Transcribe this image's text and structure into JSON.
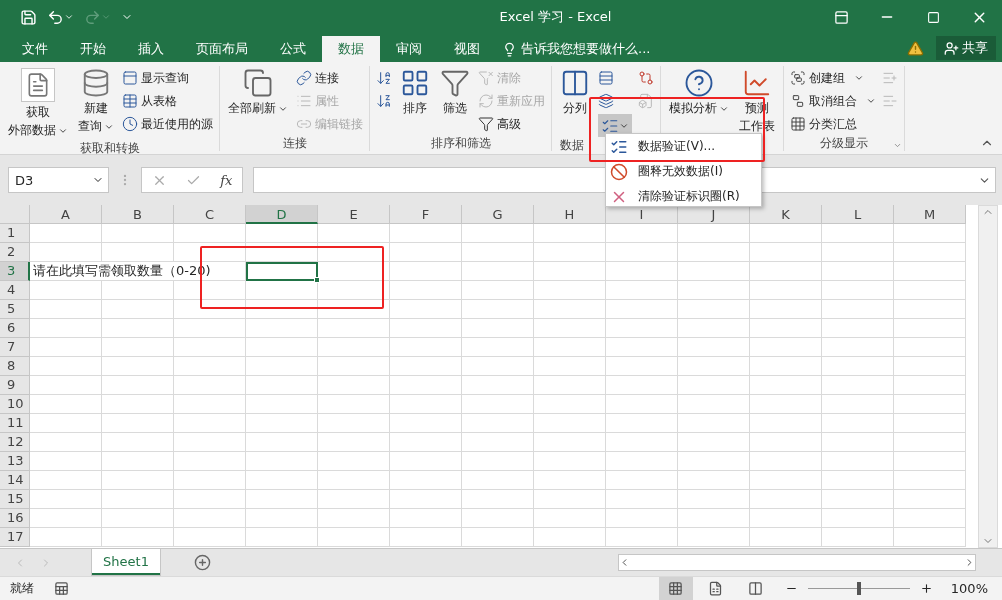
{
  "title_bar": {
    "title": "Excel 学习 - Excel",
    "redo_disabled": true
  },
  "ribbon_tabs": [
    {
      "label": "文件",
      "selected": false
    },
    {
      "label": "开始",
      "selected": false
    },
    {
      "label": "插入",
      "selected": false
    },
    {
      "label": "页面布局",
      "selected": false
    },
    {
      "label": "公式",
      "selected": false
    },
    {
      "label": "数据",
      "selected": true
    },
    {
      "label": "审阅",
      "selected": false
    },
    {
      "label": "视图",
      "selected": false
    }
  ],
  "tell_me": {
    "placeholder": "告诉我您想要做什么..."
  },
  "share_button": {
    "label": "共享"
  },
  "ribbon_groups": [
    {
      "label": "获取和转换",
      "columns": [
        {
          "kind": "large",
          "lines": [
            "获取",
            "外部数据"
          ],
          "dropdown": true,
          "boxed": true
        },
        {
          "kind": "large",
          "lines": [
            "新建",
            "查询"
          ],
          "dropdown": true,
          "boxed": false
        },
        {
          "kind": "stack",
          "items": [
            {
              "kind": "text",
              "label": "显示查询",
              "disabled": false
            },
            {
              "kind": "text",
              "label": "从表格",
              "disabled": false
            },
            {
              "kind": "text",
              "label": "最近使用的源",
              "disabled": false
            }
          ]
        }
      ]
    },
    {
      "label": "连接",
      "columns": [
        {
          "kind": "large",
          "lines": [
            "全部刷新"
          ],
          "dropdown": true,
          "boxed": false
        },
        {
          "kind": "stack",
          "items": [
            {
              "kind": "text",
              "label": "连接",
              "disabled": false
            },
            {
              "kind": "text",
              "label": "属性",
              "disabled": true
            },
            {
              "kind": "text",
              "label": "编辑链接",
              "disabled": true
            }
          ]
        }
      ]
    },
    {
      "label": "排序和筛选",
      "columns": [
        {
          "kind": "stack",
          "items": [
            {
              "kind": "icon",
              "disabled": false
            },
            {
              "kind": "icon",
              "disabled": false
            }
          ]
        },
        {
          "kind": "large",
          "lines": [
            "排序"
          ],
          "dropdown": false,
          "boxed": false
        },
        {
          "kind": "large",
          "lines": [
            "筛选"
          ],
          "dropdown": false,
          "boxed": false
        },
        {
          "kind": "stack",
          "items": [
            {
              "kind": "text",
              "label": "清除",
              "disabled": true
            },
            {
              "kind": "text",
              "label": "重新应用",
              "disabled": true
            },
            {
              "kind": "text",
              "label": "高级",
              "disabled": false
            }
          ]
        }
      ]
    },
    {
      "label": "数据",
      "columns": [
        {
          "kind": "large",
          "lines": [
            "分列"
          ],
          "dropdown": false,
          "boxed": false
        },
        {
          "kind": "stack",
          "items": [
            {
              "kind": "icon",
              "disabled": false
            },
            {
              "kind": "icon",
              "disabled": false
            },
            {
              "kind": "split",
              "disabled": false,
              "expanded": true
            }
          ]
        },
        {
          "kind": "stack",
          "items": [
            {
              "kind": "icon",
              "disabled": false
            },
            {
              "kind": "icon",
              "disabled": true
            }
          ]
        }
      ]
    },
    {
      "columns": [
        {
          "kind": "large",
          "lines": [
            "模拟分析"
          ],
          "dropdown": true,
          "boxed": false
        },
        {
          "kind": "large",
          "lines": [
            "预测",
            "工作表"
          ],
          "dropdown": false,
          "boxed": false
        }
      ]
    },
    {
      "label": "分级显示",
      "launcher": true,
      "columns": [
        {
          "kind": "stack",
          "items": [
            {
              "kind": "text",
              "label": "创建组",
              "disabled": false,
              "dropdown": true
            },
            {
              "kind": "text",
              "label": "取消组合",
              "disabled": false,
              "dropdown": true
            },
            {
              "kind": "text",
              "label": "分类汇总",
              "disabled": false
            }
          ]
        },
        {
          "kind": "stack",
          "items": [
            {
              "kind": "icon",
              "disabled": true
            },
            {
              "kind": "icon",
              "disabled": true
            }
          ]
        }
      ]
    }
  ],
  "dropdown_menu": [
    {
      "label": "数据验证(V)..."
    },
    {
      "label": "圈释无效数据(I)"
    },
    {
      "label": "清除验证标识圈(R)"
    }
  ],
  "formula_bar": {
    "name_box": "D3",
    "function_label": "fx"
  },
  "sheet": {
    "columns": [
      {
        "label": "A",
        "selected": false
      },
      {
        "label": "B",
        "selected": false
      },
      {
        "label": "C",
        "selected": false
      },
      {
        "label": "D",
        "selected": true
      },
      {
        "label": "E",
        "selected": false
      },
      {
        "label": "F",
        "selected": false
      },
      {
        "label": "G",
        "selected": false
      },
      {
        "label": "H",
        "selected": false
      },
      {
        "label": "I",
        "selected": false
      },
      {
        "label": "J",
        "selected": false
      },
      {
        "label": "K",
        "selected": false
      },
      {
        "label": "L",
        "selected": false
      },
      {
        "label": "M",
        "selected": false
      }
    ],
    "rows": [
      {
        "label": "1",
        "selected": false
      },
      {
        "label": "2",
        "selected": false
      },
      {
        "label": "3",
        "selected": true,
        "text": "请在此填写需领取数量（0-20)"
      },
      {
        "label": "4",
        "selected": false
      },
      {
        "label": "5",
        "selected": false
      },
      {
        "label": "6",
        "selected": false
      },
      {
        "label": "7",
        "selected": false
      },
      {
        "label": "8",
        "selected": false
      },
      {
        "label": "9",
        "selected": false
      },
      {
        "label": "10",
        "selected": false
      },
      {
        "label": "11",
        "selected": false
      },
      {
        "label": "12",
        "selected": false
      },
      {
        "label": "13",
        "selected": false
      },
      {
        "label": "14",
        "selected": false
      },
      {
        "label": "15",
        "selected": false
      },
      {
        "label": "16",
        "selected": false
      },
      {
        "label": "17",
        "selected": false
      }
    ]
  },
  "sheet_tabs": [
    {
      "label": "Sheet1",
      "selected": true
    }
  ],
  "status_bar": {
    "status": "就绪",
    "views": [
      {
        "selected": true
      },
      {
        "selected": false
      },
      {
        "selected": false
      }
    ],
    "zoom": {
      "level": 0.5,
      "reading": "100%"
    }
  }
}
